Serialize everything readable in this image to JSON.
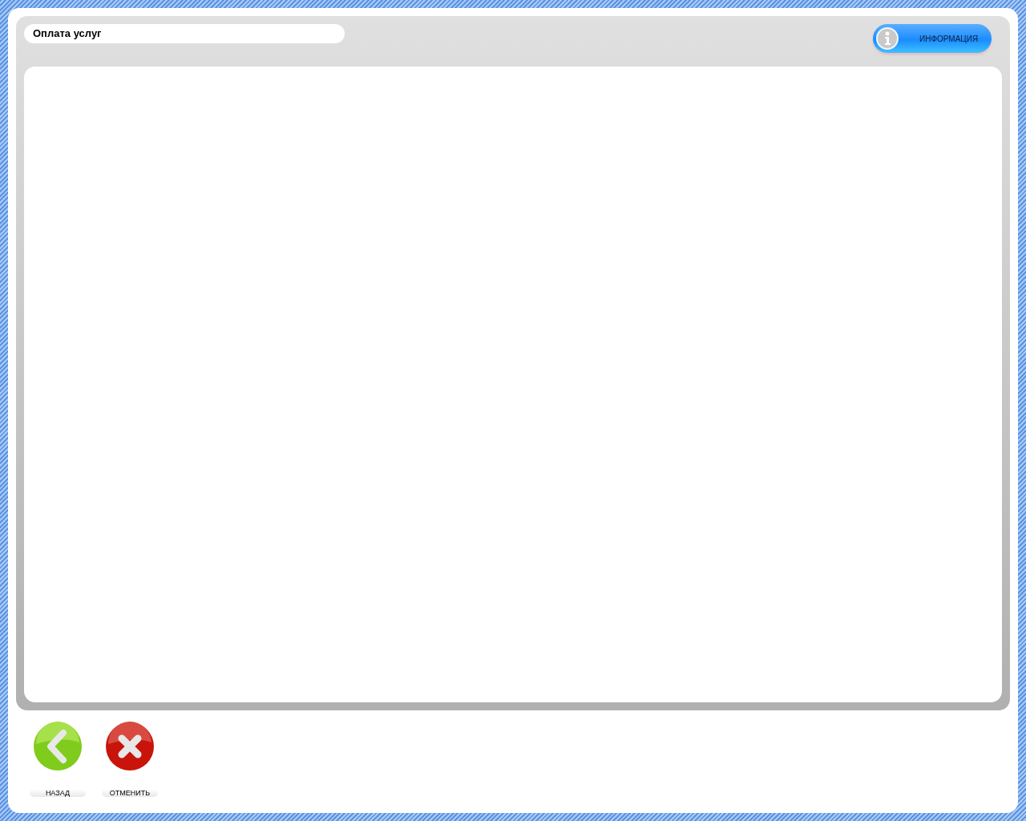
{
  "header": {
    "title": "Оплата услуг",
    "info_button": "ИНФОРМАЦИЯ"
  },
  "buttons": [
    {
      "kind": "back",
      "label": "НАЗАД"
    },
    {
      "kind": "cancel",
      "label": "ОТМЕНИТЬ"
    }
  ]
}
